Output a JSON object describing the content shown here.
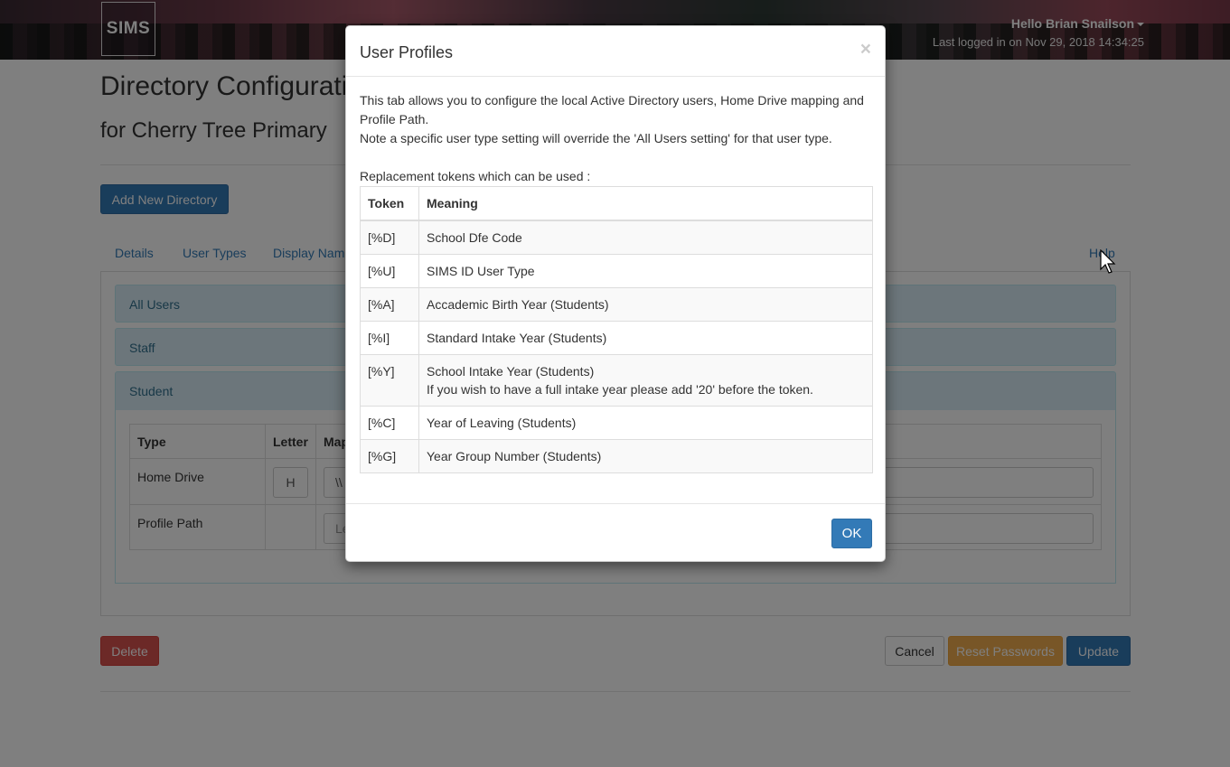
{
  "header": {
    "logo_text": "SIMS",
    "greeting": "Hello Brian Snailson",
    "last_login": "Last logged in on Nov 29, 2018 14:34:25"
  },
  "page": {
    "title": "Directory Configuration",
    "subtitle": "for Cherry Tree Primary",
    "add_button": "Add New Directory",
    "tabs": [
      "Details",
      "User Types",
      "Display Name",
      "Help"
    ],
    "accordion": [
      "All Users",
      "Staff",
      "Student"
    ],
    "table": {
      "headers": [
        "Type",
        "Letter",
        "Map"
      ],
      "rows": [
        {
          "type": "Home Drive",
          "letter": "H",
          "path": "\\\\"
        },
        {
          "type": "Profile Path",
          "letter": "",
          "path": "Le"
        }
      ]
    },
    "buttons": {
      "delete": "Delete",
      "cancel": "Cancel",
      "reset": "Reset Passwords",
      "update": "Update"
    }
  },
  "modal": {
    "title": "User Profiles",
    "close": "×",
    "intro_line1": "This tab allows you to configure the local Active Directory users, Home Drive mapping and Profile Path.",
    "intro_line2": "Note a specific user type setting will override the 'All Users setting' for that user type.",
    "tokens_label": "Replacement tokens which can be used :",
    "token_headers": [
      "Token",
      "Meaning"
    ],
    "tokens": [
      {
        "token": "[%D]",
        "meaning": "School Dfe Code"
      },
      {
        "token": "[%U]",
        "meaning": "SIMS ID User Type"
      },
      {
        "token": "[%A]",
        "meaning": "Accademic Birth Year (Students)"
      },
      {
        "token": "[%I]",
        "meaning": "Standard Intake Year (Students)"
      },
      {
        "token": "[%Y]",
        "meaning": "School Intake Year (Students)",
        "note": "If you wish to have a full intake year please add '20' before the token."
      },
      {
        "token": "[%C]",
        "meaning": "Year of Leaving (Students)"
      },
      {
        "token": "[%G]",
        "meaning": "Year Group Number (Students)"
      }
    ],
    "ok_button": "OK"
  }
}
